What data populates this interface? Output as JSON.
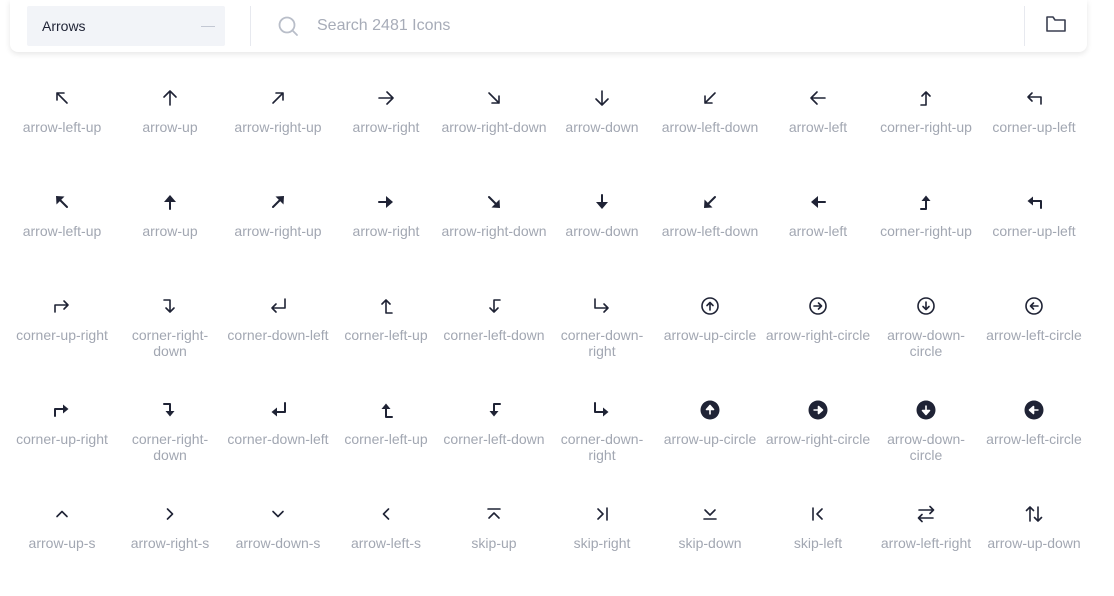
{
  "toolbar": {
    "category": "Arrows",
    "search_placeholder": "Search 2481 Icons"
  },
  "icons": [
    [
      {
        "name": "arrow-left-up-icon",
        "label": "arrow-left-up"
      },
      {
        "name": "arrow-up-icon",
        "label": "arrow-up"
      },
      {
        "name": "arrow-right-up-icon",
        "label": "arrow-right-up"
      },
      {
        "name": "arrow-right-icon",
        "label": "arrow-right"
      },
      {
        "name": "arrow-right-down-icon",
        "label": "arrow-right-down"
      },
      {
        "name": "arrow-down-icon",
        "label": "arrow-down"
      },
      {
        "name": "arrow-left-down-icon",
        "label": "arrow-left-down"
      },
      {
        "name": "arrow-left-icon",
        "label": "arrow-left"
      },
      {
        "name": "corner-right-up-icon",
        "label": "corner-right-up"
      },
      {
        "name": "corner-up-left-icon",
        "label": "corner-up-left"
      }
    ],
    [
      {
        "name": "arrow-left-up-icon",
        "label": "arrow-left-up"
      },
      {
        "name": "arrow-up-icon",
        "label": "arrow-up"
      },
      {
        "name": "arrow-right-up-icon",
        "label": "arrow-right-up"
      },
      {
        "name": "arrow-right-icon",
        "label": "arrow-right"
      },
      {
        "name": "arrow-right-down-icon",
        "label": "arrow-right-down"
      },
      {
        "name": "arrow-down-icon",
        "label": "arrow-down"
      },
      {
        "name": "arrow-left-down-icon",
        "label": "arrow-left-down"
      },
      {
        "name": "arrow-left-icon",
        "label": "arrow-left"
      },
      {
        "name": "corner-right-up-icon",
        "label": "corner-right-up"
      },
      {
        "name": "corner-up-left-icon",
        "label": "corner-up-left"
      }
    ],
    [
      {
        "name": "corner-up-right-icon",
        "label": "corner-up-right"
      },
      {
        "name": "corner-right-down-icon",
        "label": "corner-right-down"
      },
      {
        "name": "corner-down-left-icon",
        "label": "corner-down-left"
      },
      {
        "name": "corner-left-up-icon",
        "label": "corner-left-up"
      },
      {
        "name": "corner-left-down-icon",
        "label": "corner-left-down"
      },
      {
        "name": "corner-down-right-icon",
        "label": "corner-down-right"
      },
      {
        "name": "arrow-up-circle-icon",
        "label": "arrow-up-circle"
      },
      {
        "name": "arrow-right-circle-icon",
        "label": "arrow-right-circle"
      },
      {
        "name": "arrow-down-circle-icon",
        "label": "arrow-down-circle"
      },
      {
        "name": "arrow-left-circle-icon",
        "label": "arrow-left-circle"
      }
    ],
    [
      {
        "name": "corner-up-right-icon",
        "label": "corner-up-right"
      },
      {
        "name": "corner-right-down-icon",
        "label": "corner-right-down"
      },
      {
        "name": "corner-down-left-icon",
        "label": "corner-down-left"
      },
      {
        "name": "corner-left-up-icon",
        "label": "corner-left-up"
      },
      {
        "name": "corner-left-down-icon",
        "label": "corner-left-down"
      },
      {
        "name": "corner-down-right-icon",
        "label": "corner-down-right"
      },
      {
        "name": "arrow-up-circle-icon",
        "label": "arrow-up-circle"
      },
      {
        "name": "arrow-right-circle-icon",
        "label": "arrow-right-circle"
      },
      {
        "name": "arrow-down-circle-icon",
        "label": "arrow-down-circle"
      },
      {
        "name": "arrow-left-circle-icon",
        "label": "arrow-left-circle"
      }
    ],
    [
      {
        "name": "arrow-up-s-icon",
        "label": "arrow-up-s"
      },
      {
        "name": "arrow-right-s-icon",
        "label": "arrow-right-s"
      },
      {
        "name": "arrow-down-s-icon",
        "label": "arrow-down-s"
      },
      {
        "name": "arrow-left-s-icon",
        "label": "arrow-left-s"
      },
      {
        "name": "skip-up-icon",
        "label": "skip-up"
      },
      {
        "name": "skip-right-icon",
        "label": "skip-right"
      },
      {
        "name": "skip-down-icon",
        "label": "skip-down"
      },
      {
        "name": "skip-left-icon",
        "label": "skip-left"
      },
      {
        "name": "arrow-left-right-icon",
        "label": "arrow-left-right"
      },
      {
        "name": "arrow-up-down-icon",
        "label": "arrow-up-down"
      }
    ]
  ],
  "colors": {
    "icon": "#1f2335",
    "label": "#a2a7b2",
    "placeholder": "#a7acb8",
    "category_bg": "#f2f4f8"
  }
}
